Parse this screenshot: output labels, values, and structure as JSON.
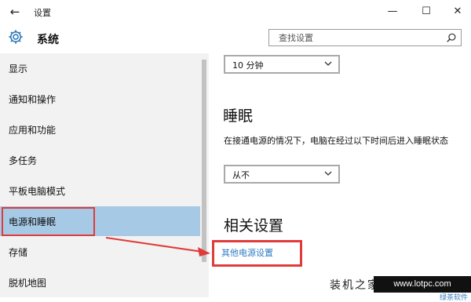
{
  "window": {
    "title": "设置",
    "back_glyph": "←",
    "min_glyph": "—",
    "max_glyph": "☐",
    "close_glyph": "✕"
  },
  "header": {
    "title": "系统",
    "search_placeholder": "查找设置"
  },
  "sidebar": {
    "items": [
      {
        "label": "显示"
      },
      {
        "label": "通知和操作"
      },
      {
        "label": "应用和功能"
      },
      {
        "label": "多任务"
      },
      {
        "label": "平板电脑模式"
      },
      {
        "label": "电源和睡眠",
        "selected": true
      },
      {
        "label": "存储"
      },
      {
        "label": "脱机地图"
      }
    ]
  },
  "content": {
    "screen_dropdown_value": "10 分钟",
    "sleep_heading": "睡眠",
    "sleep_description": "在接通电源的情况下，电脑在经过以下时间后进入睡眠状态",
    "sleep_dropdown_value": "从不",
    "related_heading": "相关设置",
    "related_link": "其他电源设置"
  },
  "watermark": {
    "text": "装机之家",
    "url": "www.lotpc.com",
    "sub": "绿茶软件"
  },
  "colors": {
    "selected_bg": "#a6c9e6",
    "highlight_red": "#e03b3b",
    "link_blue": "#2b7bc4",
    "sidebar_bg": "#f2f2f2"
  }
}
